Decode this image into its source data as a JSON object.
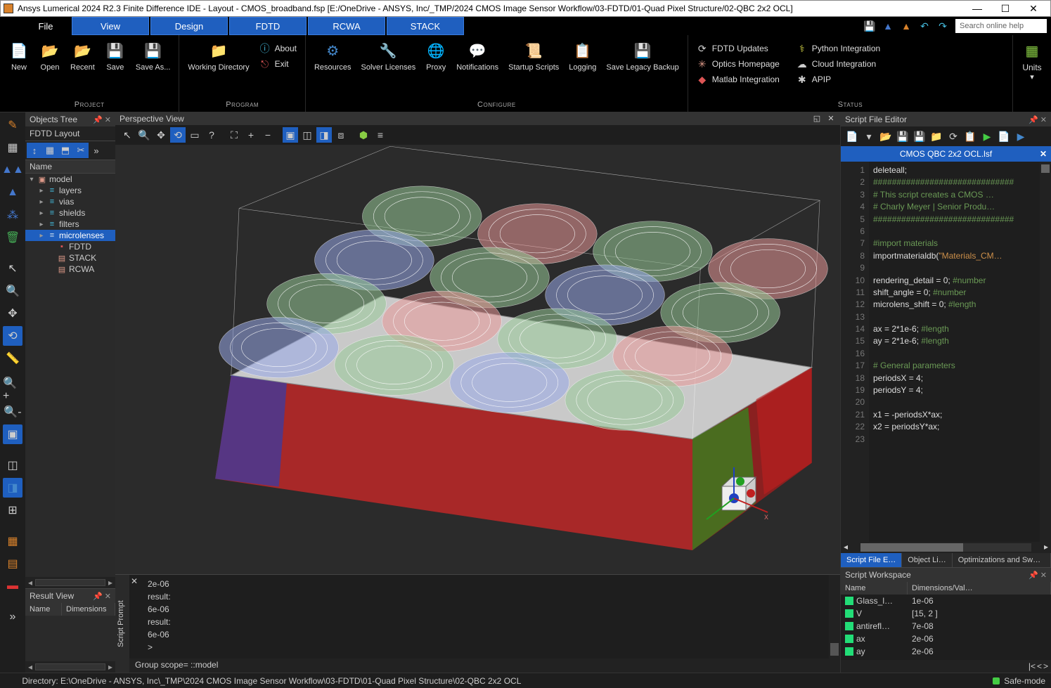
{
  "title": "Ansys Lumerical 2024 R2.3 Finite Difference IDE - Layout - CMOS_broadband.fsp [E:/OneDrive - ANSYS, Inc/_TMP/2024 CMOS Image Sensor Workflow/03-FDTD/01-Quad Pixel Structure/02-QBC 2x2 OCL]",
  "menu_tabs": {
    "file": "File",
    "view": "View",
    "design": "Design",
    "fdtd": "FDTD",
    "rcwa": "RCWA",
    "stack": "STACK"
  },
  "search_placeholder": "Search online help",
  "ribbon": {
    "project": {
      "label": "Project",
      "new": "New",
      "open": "Open",
      "recent": "Recent",
      "save": "Save",
      "save_as": "Save\nAs..."
    },
    "program": {
      "label": "Program",
      "working_dir": "Working\nDirectory",
      "about": "About",
      "exit": "Exit"
    },
    "configure": {
      "label": "Configure",
      "resources": "Resources",
      "solver": "Solver\nLicenses",
      "proxy": "Proxy",
      "notifications": "Notifications",
      "startup": "Startup\nScripts",
      "logging": "Logging",
      "legacy": "Save\nLegacy Backup"
    },
    "status": {
      "label": "Status",
      "fdtd_updates": "FDTD Updates",
      "optics_home": "Optics Homepage",
      "matlab": "Matlab Integration",
      "python": "Python Integration",
      "cloud": "Cloud Integration",
      "apip": "APIP"
    },
    "units": "Units"
  },
  "objects_tree": {
    "title": "Objects Tree",
    "dropdown": "FDTD Layout",
    "header": "Name",
    "nodes": {
      "model": "model",
      "layers": "layers",
      "vias": "vias",
      "shields": "shields",
      "filters": "filters",
      "microlenses": "microlenses",
      "fdtd": "FDTD",
      "stack": "STACK",
      "rcwa": "RCWA"
    }
  },
  "result_view": {
    "title": "Result View",
    "cols": {
      "name": "Name",
      "dims": "Dimensions"
    }
  },
  "viewport": {
    "title": "Perspective View"
  },
  "script_prompt": {
    "label": "Script Prompt",
    "lines": [
      "2e-06",
      "result:",
      "6e-06",
      "result:",
      "6e-06",
      ">"
    ],
    "group_scope": "Group scope= ::model"
  },
  "statusbar": {
    "directory": "Directory: E:\\OneDrive - ANSYS, Inc\\_TMP\\2024 CMOS Image Sensor Workflow\\03-FDTD\\01-Quad Pixel Structure\\02-QBC 2x2 OCL",
    "safe_mode": "Safe-mode"
  },
  "editor": {
    "title": "Script File Editor",
    "tab": "CMOS QBC 2x2 OCL.lsf",
    "gutter": [
      "1",
      "2",
      "3",
      "4",
      "5",
      "6",
      "7",
      "8",
      "9",
      "10",
      "11",
      "12",
      "13",
      "14",
      "15",
      "16",
      "17",
      "18",
      "19",
      "20",
      "21",
      "22",
      "23"
    ],
    "lines": [
      {
        "t": "deleteall;"
      },
      {
        "t": "##############################",
        "cls": "c-cmt"
      },
      {
        "t": "# This script creates a CMOS …",
        "cls": "c-cmt"
      },
      {
        "t": "# Charly Meyer | Senior Produ…",
        "cls": "c-cmt"
      },
      {
        "t": "##############################",
        "cls": "c-cmt"
      },
      {
        "t": ""
      },
      {
        "t": "#import materials",
        "cls": "c-cmt"
      },
      {
        "segments": [
          {
            "t": "importmaterialdb("
          },
          {
            "t": "\"Materials_CM…",
            "cls": "c-str"
          }
        ]
      },
      {
        "t": ""
      },
      {
        "segments": [
          {
            "t": "rendering_detail = 0; "
          },
          {
            "t": "#number",
            "cls": "c-cmt"
          }
        ]
      },
      {
        "segments": [
          {
            "t": "shift_angle = 0; "
          },
          {
            "t": "#number",
            "cls": "c-cmt"
          }
        ]
      },
      {
        "segments": [
          {
            "t": "microlens_shift = 0; "
          },
          {
            "t": "#length",
            "cls": "c-cmt"
          }
        ]
      },
      {
        "t": ""
      },
      {
        "segments": [
          {
            "t": "ax = 2*1e-6; "
          },
          {
            "t": "#length",
            "cls": "c-cmt"
          }
        ]
      },
      {
        "segments": [
          {
            "t": "ay = 2*1e-6; "
          },
          {
            "t": "#length",
            "cls": "c-cmt"
          }
        ]
      },
      {
        "t": ""
      },
      {
        "t": "# General parameters",
        "cls": "c-cmt"
      },
      {
        "t": "periodsX = 4;"
      },
      {
        "t": "periodsY = 4;"
      },
      {
        "t": ""
      },
      {
        "t": "x1 = -periodsX*ax;"
      },
      {
        "t": "x2 = periodsY*ax;"
      },
      {
        "t": ""
      }
    ],
    "bottom_tabs": {
      "script": "Script File E…",
      "objlib": "Object Li…",
      "opt": "Optimizations and Sw…"
    }
  },
  "workspace": {
    "title": "Script Workspace",
    "cols": {
      "name": "Name",
      "dimval": "Dimensions/Val…"
    },
    "rows": [
      {
        "name": "Glass_l…",
        "val": "1e-06"
      },
      {
        "name": "V",
        "val": "[15, 2 ]"
      },
      {
        "name": "antirefl…",
        "val": "7e-08"
      },
      {
        "name": "ax",
        "val": "2e-06"
      },
      {
        "name": "ay",
        "val": "2e-06"
      }
    ]
  }
}
